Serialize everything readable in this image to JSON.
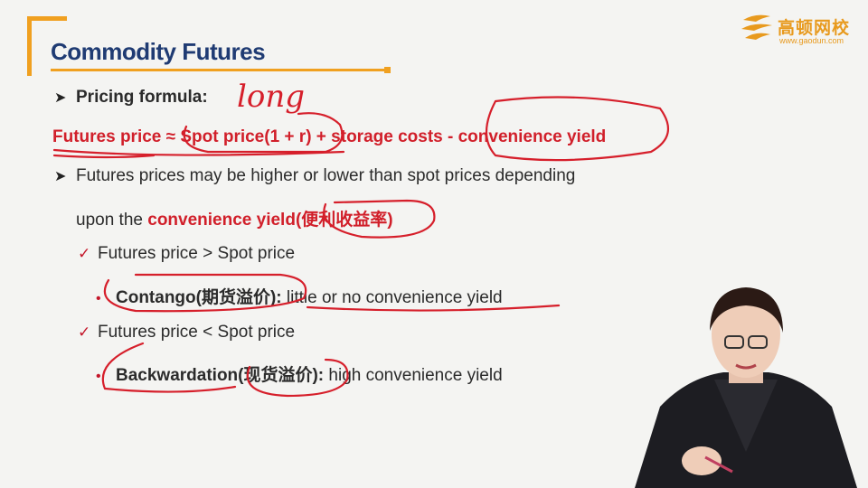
{
  "slide": {
    "title": "Commodity Futures",
    "logo": {
      "cn": "高顿网校",
      "url": "www.gaodun.com"
    },
    "pricing_label": "Pricing formula:",
    "formula": "Futures price ≈ Spot price(1 + r) + storage costs - convenience yield",
    "point1_a": "Futures prices may be higher or lower than spot prices depending",
    "point1_b_prefix": "upon the ",
    "point1_b_red": "convenience yield",
    "point1_b_cn": "(便利收益率)",
    "case1": "Futures price > Spot price",
    "case1_term": "Contango(期货溢价):",
    "case1_desc": " little or no convenience yield",
    "case2": "Futures price < Spot price",
    "case2_term": "Backwardation(现货溢价):",
    "case2_desc": " high convenience yield",
    "handwriting": "long"
  },
  "colors": {
    "title": "#1f3b73",
    "accent": "#f0a020",
    "emphasis": "#d11f2a"
  },
  "icons": [
    "arrow-bullet-icon",
    "check-icon",
    "dot-bullet-icon",
    "gaodun-logo-icon"
  ]
}
